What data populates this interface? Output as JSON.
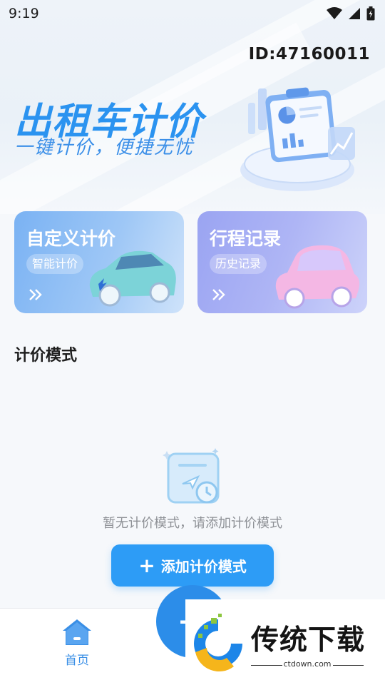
{
  "status_bar": {
    "time": "9:19"
  },
  "header": {
    "user_id": "ID:47160011"
  },
  "hero": {
    "title": "出租车计价",
    "subtitle": "一键计价，便捷无忧"
  },
  "cards": [
    {
      "title": "自定义计价",
      "tag": "智能计价",
      "icon": "double-chevron-right-icon"
    },
    {
      "title": "行程记录",
      "tag": "历史记录",
      "icon": "double-chevron-right-icon"
    }
  ],
  "section": {
    "title": "计价模式"
  },
  "empty_state": {
    "message": "暂无计价模式，请添加计价模式",
    "button_label": "添加计价模式",
    "button_icon": "plus-icon"
  },
  "tab_bar": {
    "items": [
      {
        "label": "首页",
        "icon": "home-icon",
        "active": true
      }
    ],
    "center_action_icon": "plus-icon"
  },
  "watermark": {
    "brand": "传统下载",
    "domain": "ctdown.com"
  },
  "colors": {
    "accent": "#2d9cf6",
    "hero_title": "#2b93f0",
    "card_custom": "#7ab2f3",
    "card_trips": "#9aa4f2",
    "tab_active": "#3a8fe6"
  }
}
